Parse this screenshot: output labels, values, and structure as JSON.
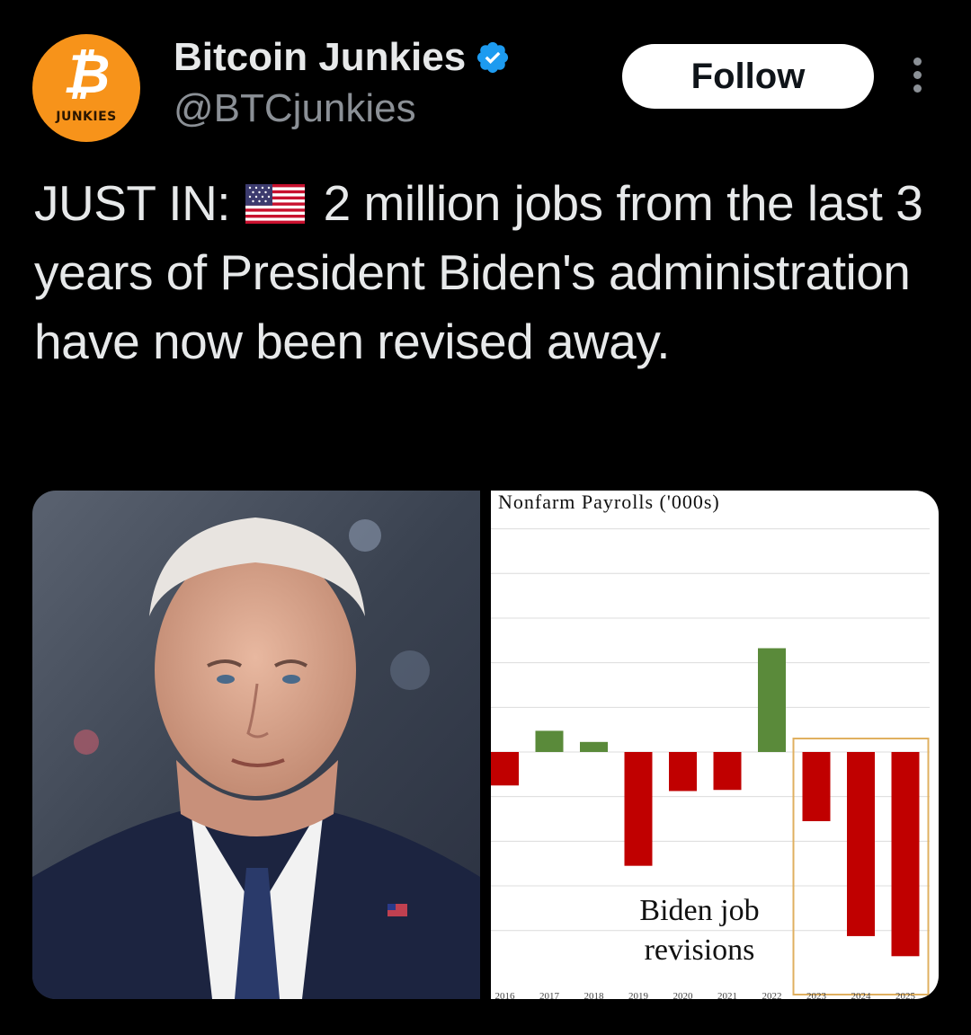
{
  "header": {
    "display_name": "Bitcoin Junkies",
    "handle": "@BTCjunkies",
    "follow_label": "Follow",
    "avatar_symbol": "₿",
    "avatar_label": "JUNKIES",
    "verified_icon": "verified-badge-icon",
    "more_icon": "more-vertical-icon"
  },
  "tweet": {
    "prefix": "JUST IN:",
    "flag_icon": "us-flag-icon",
    "text": "2 million jobs from the last 3 years of President Biden's administration have now been revised away."
  },
  "colors": {
    "accent": "#1d9bf0",
    "avatar": "#f7931a",
    "bar_positive": "#5a8a3a",
    "bar_negative": "#c00000",
    "highlight_box": "#e0b060"
  },
  "chart_data": {
    "type": "bar",
    "title": "Nonfarm Payrolls ('000s)",
    "categories": [
      "2016",
      "2017",
      "2018",
      "2019",
      "2020",
      "2021",
      "2022",
      "2023",
      "2024",
      "2025"
    ],
    "values": [
      -150,
      95,
      45,
      -510,
      -175,
      -170,
      465,
      -310,
      -825,
      -915
    ],
    "annotation": "Biden job revisions",
    "highlighted_categories": [
      "2023",
      "2024",
      "2025"
    ],
    "grid": "horizontal",
    "ylim": [
      -1000,
      1000
    ]
  }
}
